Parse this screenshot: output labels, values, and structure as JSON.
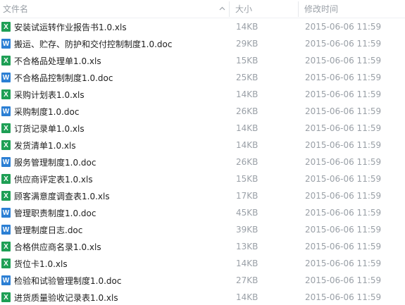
{
  "header": {
    "name_label": "文件名",
    "size_label": "大小",
    "date_label": "修改时间"
  },
  "files": [
    {
      "name": "安装试运转作业报告书1.0.xls",
      "size": "14KB",
      "modified": "2015-06-06 11:59",
      "type": "xls",
      "icon_glyph": "X"
    },
    {
      "name": "搬运、贮存、防护和交付控制制度1.0.doc",
      "size": "29KB",
      "modified": "2015-06-06 11:59",
      "type": "doc",
      "icon_glyph": "W"
    },
    {
      "name": "不合格品处理单1.0.xls",
      "size": "15KB",
      "modified": "2015-06-06 11:59",
      "type": "xls",
      "icon_glyph": "X"
    },
    {
      "name": "不合格品控制制度1.0.doc",
      "size": "25KB",
      "modified": "2015-06-06 11:59",
      "type": "doc",
      "icon_glyph": "W"
    },
    {
      "name": "采购计划表1.0.xls",
      "size": "14KB",
      "modified": "2015-06-06 11:59",
      "type": "xls",
      "icon_glyph": "X"
    },
    {
      "name": "采购制度1.0.doc",
      "size": "26KB",
      "modified": "2015-06-06 11:59",
      "type": "doc",
      "icon_glyph": "W"
    },
    {
      "name": "订货记录单1.0.xls",
      "size": "14KB",
      "modified": "2015-06-06 11:59",
      "type": "xls",
      "icon_glyph": "X"
    },
    {
      "name": "发货清单1.0.xls",
      "size": "14KB",
      "modified": "2015-06-06 11:59",
      "type": "xls",
      "icon_glyph": "X"
    },
    {
      "name": "服务管理制度1.0.doc",
      "size": "26KB",
      "modified": "2015-06-06 11:59",
      "type": "doc",
      "icon_glyph": "W"
    },
    {
      "name": "供应商评定表1.0.xls",
      "size": "15KB",
      "modified": "2015-06-06 11:59",
      "type": "xls",
      "icon_glyph": "X"
    },
    {
      "name": "顾客满意度调查表1.0.xls",
      "size": "17KB",
      "modified": "2015-06-06 11:59",
      "type": "xls",
      "icon_glyph": "X"
    },
    {
      "name": "管理职责制度1.0.doc",
      "size": "45KB",
      "modified": "2015-06-06 11:59",
      "type": "doc",
      "icon_glyph": "W"
    },
    {
      "name": "管理制度日志.doc",
      "size": "39KB",
      "modified": "2015-06-06 11:59",
      "type": "doc",
      "icon_glyph": "W"
    },
    {
      "name": "合格供应商名录1.0.xls",
      "size": "13KB",
      "modified": "2015-06-06 11:59",
      "type": "xls",
      "icon_glyph": "X"
    },
    {
      "name": "货位卡1.0.xls",
      "size": "14KB",
      "modified": "2015-06-06 11:59",
      "type": "xls",
      "icon_glyph": "X"
    },
    {
      "name": "检验和试验管理制度1.0.doc",
      "size": "27KB",
      "modified": "2015-06-06 11:59",
      "type": "doc",
      "icon_glyph": "W"
    },
    {
      "name": "进货质量验收记录表1.0.xls",
      "size": "14KB",
      "modified": "2015-06-06 11:59",
      "type": "xls",
      "icon_glyph": "X"
    }
  ],
  "colors": {
    "xls_icon": "#1e9f55",
    "doc_icon": "#2b7fd4",
    "header_text": "#9aa0a7",
    "meta_text": "#9aa0a7",
    "name_text": "#1e1e1e"
  },
  "icons": {
    "sort": "sort-up-chevron-icon",
    "xls": "excel-file-icon",
    "doc": "word-file-icon"
  }
}
